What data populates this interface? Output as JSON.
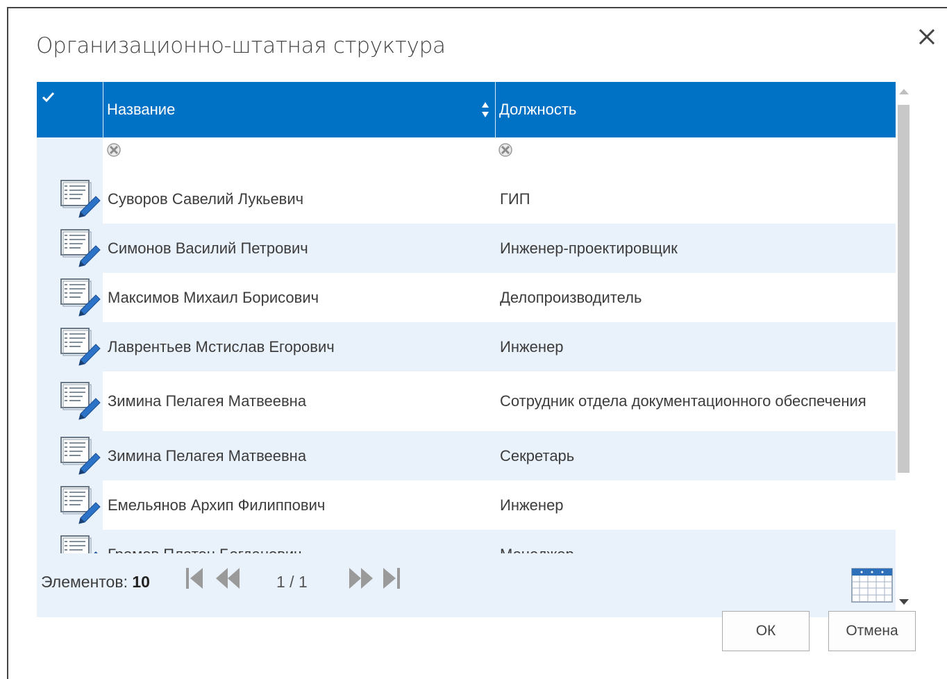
{
  "dialog": {
    "title": "Организационно-штатная структура",
    "close_icon": "close-icon"
  },
  "grid": {
    "header": {
      "select_all_icon": "checkmark-icon",
      "columns": [
        {
          "label": "Название",
          "sort_icon": "sort-updown-icon"
        },
        {
          "label": "Должность"
        }
      ]
    },
    "filter_icons": [
      "clear-filter-icon",
      "clear-filter-icon"
    ],
    "rows": [
      {
        "name": "Суворов Савелий Лукьевич",
        "position": "ГИП"
      },
      {
        "name": "Симонов Василий Петрович",
        "position": "Инженер-проектировщик"
      },
      {
        "name": "Максимов Михаил Борисович",
        "position": "Делопроизводитель"
      },
      {
        "name": "Лаврентьев Мстислав Егорович",
        "position": "Инженер"
      },
      {
        "name": "Зимина Пелагея Матвеевна",
        "position": "Сотрудник отдела документационного обеспечения"
      },
      {
        "name": "Зимина Пелагея Матвеевна",
        "position": "Секретарь"
      },
      {
        "name": "Емельянов Архип Филиппович",
        "position": "Инженер"
      },
      {
        "name": "Громов Платон Богданович",
        "position": "Менеджер"
      }
    ],
    "row_icon": "edit-document-icon",
    "footer": {
      "count_label": "Элементов:",
      "count_value": "10",
      "page_indicator": "1 / 1",
      "pager_icons": [
        "first-page-icon",
        "previous-page-icon",
        "next-page-icon",
        "last-page-icon"
      ],
      "calendar_icon": "calendar-icon"
    }
  },
  "buttons": {
    "ok": "ОК",
    "cancel": "Отмена"
  },
  "colors": {
    "header_blue": "#0072c6",
    "row_alt_blue": "#e9f1fb",
    "scroll_thumb": "#c8c8c8"
  }
}
